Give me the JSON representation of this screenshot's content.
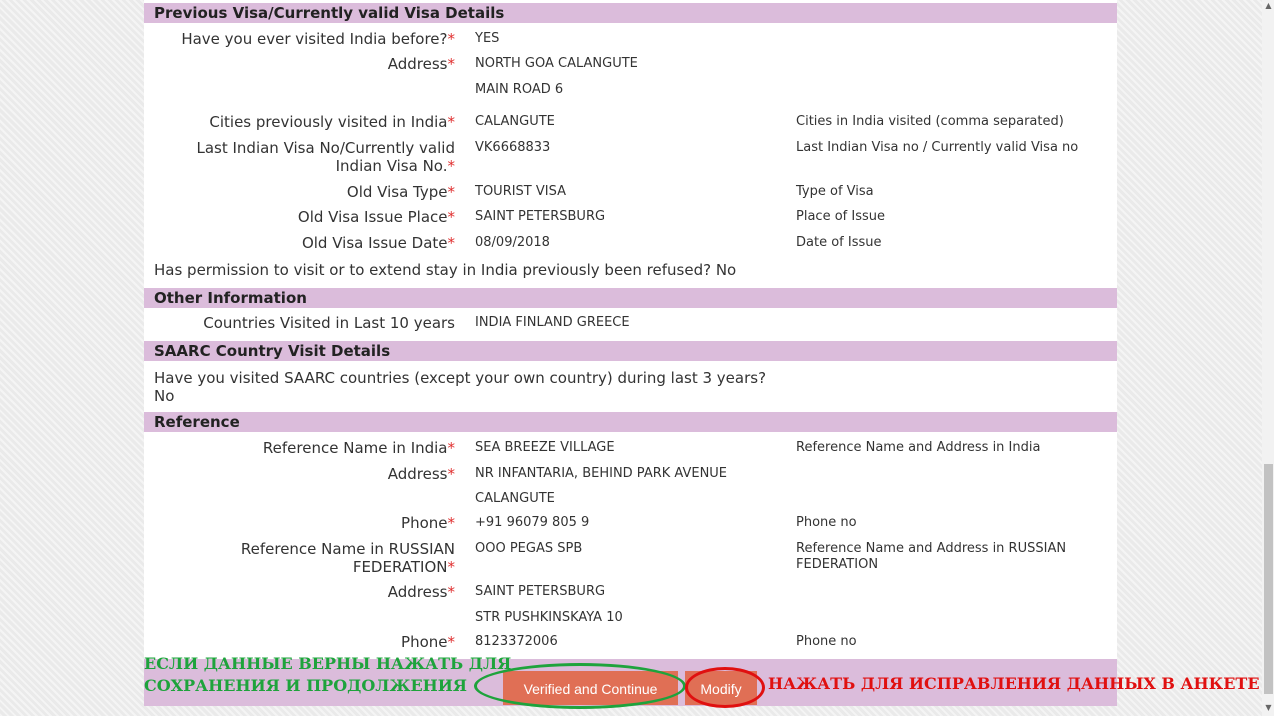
{
  "sections": {
    "previous_visa": "Previous Visa/Currently valid Visa Details",
    "other_info": "Other Information",
    "saarc": "SAARC Country Visit Details",
    "reference": "Reference"
  },
  "required_marker": "*",
  "previous_visa": {
    "visited_label": "Have you ever visited India before?",
    "visited_value": "YES",
    "address_label": "Address",
    "address_line1": "NORTH GOA CALANGUTE",
    "address_line2": "MAIN ROAD 6",
    "cities_label": "Cities previously visited in India",
    "cities_value": "CALANGUTE",
    "cities_hint": "Cities in India visited (comma separated)",
    "visa_no_label_1": "Last Indian Visa No/Currently valid",
    "visa_no_label_2": "Indian Visa No.",
    "visa_no_value": "VK6668833",
    "visa_no_hint": "Last Indian Visa no / Currently valid Visa no",
    "visa_type_label": "Old Visa Type",
    "visa_type_value": "TOURIST VISA",
    "visa_type_hint": "Type of Visa",
    "issue_place_label": "Old Visa Issue Place",
    "issue_place_value": "SAINT PETERSBURG",
    "issue_place_hint": "Place of Issue",
    "issue_date_label": "Old Visa Issue Date",
    "issue_date_value": "08/09/2018",
    "issue_date_hint": "Date of Issue",
    "refused_text": "Has permission to visit or to extend stay in India previously been refused? No"
  },
  "other_info": {
    "countries_label": "Countries Visited in Last 10 years",
    "countries_value": "INDIA FINLAND GREECE"
  },
  "saarc": {
    "question": "Have you visited SAARC countries (except your own country) during last 3 years?",
    "answer": "No"
  },
  "reference": {
    "india_name_label": "Reference Name in India",
    "india_name_value": "SEA BREEZE VILLAGE",
    "india_name_hint": "Reference Name and Address in India",
    "india_address_label": "Address",
    "india_address_line1": "NR INFANTARIA, BEHIND PARK AVENUE",
    "india_address_line2": "CALANGUTE",
    "india_phone_label": "Phone",
    "india_phone_value": "+91 96079 805 9",
    "india_phone_hint": "Phone no",
    "ru_name_label_1": "Reference Name in RUSSIAN",
    "ru_name_label_2": "FEDERATION",
    "ru_name_value": "OOO PEGAS SPB",
    "ru_name_hint_1": "Reference Name and Address in RUSSIAN",
    "ru_name_hint_2": "FEDERATION",
    "ru_address_label": "Address",
    "ru_address_line1": "SAINT PETERSBURG",
    "ru_address_line2": "STR PUSHKINSKAYA 10",
    "ru_phone_label": "Phone",
    "ru_phone_value": "8123372006",
    "ru_phone_hint": "Phone no"
  },
  "actions": {
    "verify_label": "Verified and Continue",
    "modify_label": "Modify"
  },
  "annotations": {
    "green_line1": "ЕСЛИ ДАННЫЕ ВЕРНЫ НАЖАТЬ ДЛЯ",
    "green_line2": "СОХРАНЕНИЯ И ПРОДОЛЖЕНИЯ",
    "red": "НАЖАТЬ ДЛЯ ИСПРАВЛЕНИЯ ДАННЫХ В АНКЕТЕ",
    "green_color": "#1ea33c",
    "red_color": "#e01010"
  },
  "scrollbar": {
    "up_icon": "triangle-up-icon",
    "down_icon": "triangle-down-icon"
  },
  "colors": {
    "section_header_bg": "#dbbcdb",
    "button_bg": "#e06f55",
    "required": "#e03030"
  }
}
